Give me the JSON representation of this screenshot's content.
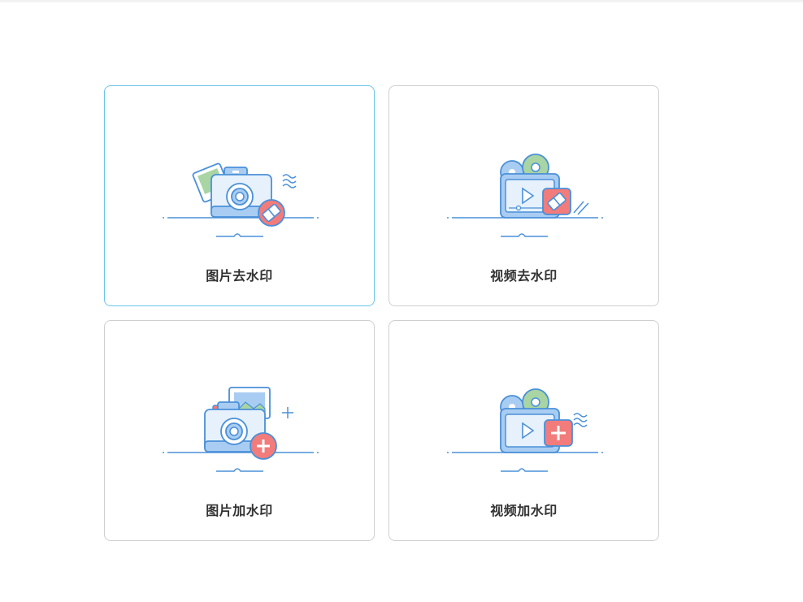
{
  "cards": [
    {
      "label": "图片去水印",
      "icon": "camera-eraser-icon",
      "active": true
    },
    {
      "label": "视频去水印",
      "icon": "video-eraser-icon",
      "active": false
    },
    {
      "label": "图片加水印",
      "icon": "camera-add-icon",
      "active": false
    },
    {
      "label": "视频加水印",
      "icon": "video-add-icon",
      "active": false
    }
  ],
  "colors": {
    "active_border": "#6cc4ea",
    "border": "#cfcfcf",
    "line_blue": "#4a90d9",
    "fill_blue": "#a9cdf2",
    "fill_light": "#e6f1fc",
    "badge_red": "#f27b7b",
    "green": "#a8d5a3"
  }
}
